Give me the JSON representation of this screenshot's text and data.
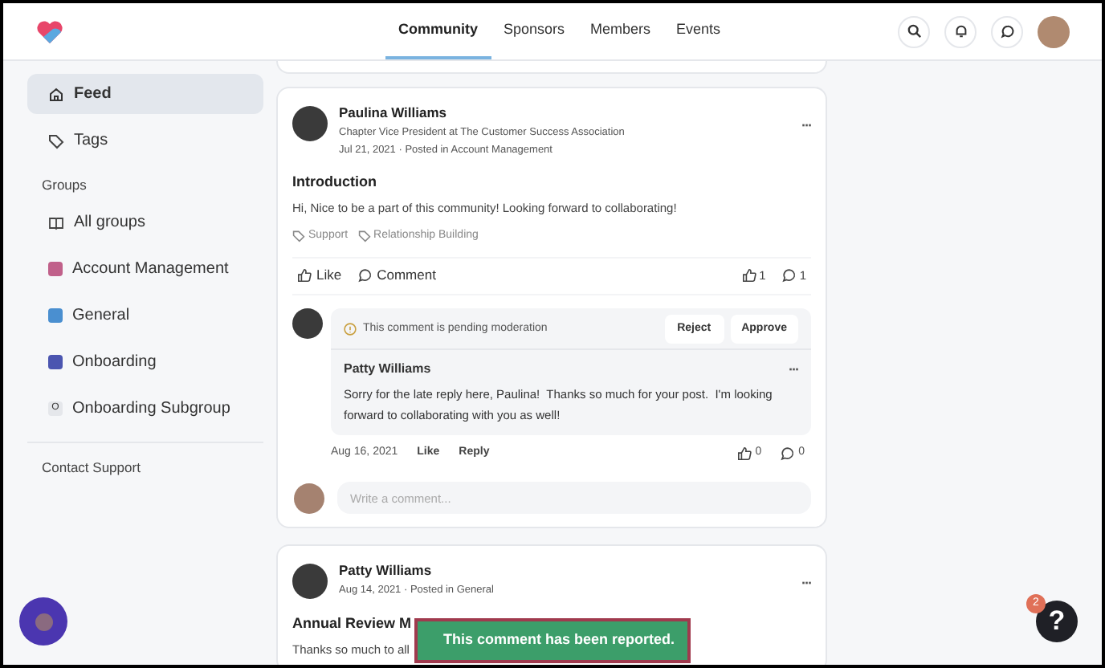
{
  "nav": {
    "tabs": [
      {
        "label": "Community",
        "selected": true
      },
      {
        "label": "Sponsors",
        "selected": false
      },
      {
        "label": "Members",
        "selected": false
      },
      {
        "label": "Events",
        "selected": false
      }
    ]
  },
  "sidebar": {
    "items": [
      {
        "kind": "nav",
        "label": "Feed",
        "selected": true
      },
      {
        "kind": "nav",
        "label": "Tags",
        "selected": false
      },
      {
        "kind": "heading",
        "label": "Groups"
      },
      {
        "kind": "nav",
        "label": "All groups",
        "selected": false
      },
      {
        "kind": "group",
        "color": "#c0608a",
        "label": "Account Management",
        "selected": false
      },
      {
        "kind": "group",
        "color": "#4a8fd0",
        "label": "General",
        "selected": false
      },
      {
        "kind": "group",
        "color": "#4b55b0",
        "label": "Onboarding",
        "selected": false
      },
      {
        "kind": "letter",
        "letter": "O",
        "label": "Onboarding Subgroup",
        "selected": false
      },
      {
        "kind": "divider"
      },
      {
        "kind": "heading",
        "label": "Contact Support"
      }
    ]
  },
  "posts": [
    {
      "author": "Paulina Williams",
      "subtitle": "Chapter Vice President at The Customer Success Association",
      "meta": "Jul 21, 2021 · Posted in Account Management",
      "more": "···",
      "title": "Introduction",
      "body": "Hi, Nice to be a part of this community! Looking forward to collaborating!",
      "tags": [
        "Support",
        "Relationship Building"
      ],
      "like_label": "Like",
      "comment_label": "Comment",
      "likes": "1",
      "comments": "1",
      "comment": {
        "notice": "This comment is pending moderation",
        "reject": "Reject",
        "approve": "Approve",
        "author": "Patty Williams",
        "more": "···",
        "text": "Sorry for the late reply here, Paulina!  Thanks so much for your post.  I'm looking forward to collaborating with you as well!",
        "date": "Aug 16, 2021",
        "like_label": "Like",
        "reply_label": "Reply",
        "likes": "0",
        "replies": "0"
      },
      "comment_placeholder": "Write a comment..."
    },
    {
      "author": "Patty Williams",
      "meta": "Aug 14, 2021 · Posted in General",
      "more": "···",
      "title": "Annual Review M",
      "body": "Thanks so much to all"
    }
  ],
  "toast": {
    "text": "This comment has been reported."
  },
  "help": {
    "label": "?",
    "badge": "2"
  }
}
